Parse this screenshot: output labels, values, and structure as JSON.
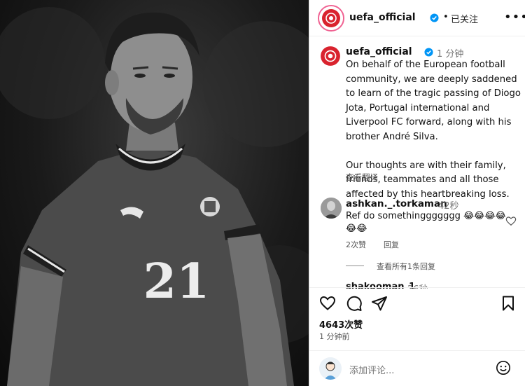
{
  "post": {
    "username": "uefa_official",
    "follow_status": "已关注",
    "more_menu": "•••",
    "time_ago": "1 分钟",
    "caption": "On behalf of the European football community, we are deeply saddened to learn of the tragic passing of Diogo Jota, Portugal international and Liverpool FC forward, along with his brother André Silva.\n\nOur thoughts are with their family, friends, teammates and all those affected by this heartbreaking loss.",
    "see_translation": "查看翻译",
    "photo_number": "21"
  },
  "comments": [
    {
      "username": "ashkan._.torkaman",
      "time": "42秒",
      "text": "Ref do somethinggggggg 😂😂😂😂😂😂",
      "likes": "2次赞",
      "reply": "回复",
      "view_replies": "查看所有1条回复"
    },
    {
      "username": "shakooman_1",
      "time": "26秒"
    }
  ],
  "actions": {
    "like_count": "4643次赞",
    "post_time": "1 分钟前"
  },
  "add_comment": {
    "placeholder": "添加评论..."
  },
  "colors": {
    "verified": "#0095f6",
    "uefa_red": "#d9232e",
    "story_ring": "#f06292"
  },
  "icons": [
    "uefa-logo-icon",
    "verified-badge-icon",
    "heart-icon",
    "comment-icon",
    "share-icon",
    "bookmark-icon",
    "emoji-icon"
  ]
}
